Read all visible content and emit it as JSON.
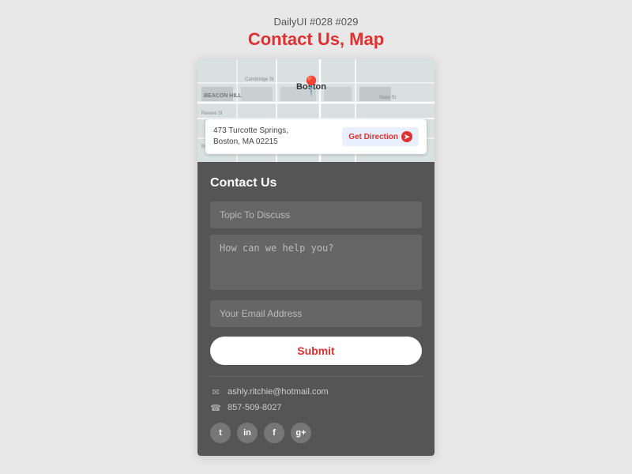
{
  "header": {
    "subtitle": "DailyUI #028 #029",
    "title": "Contact Us, Map"
  },
  "map": {
    "city_label": "Boston",
    "address_line1": "473 Turcotte Springs,",
    "address_line2": "Boston,  MA 02215",
    "direction_btn_label": "Get Direction"
  },
  "contact_form": {
    "heading": "Contact Us",
    "topic_placeholder": "Topic To Discuss",
    "message_placeholder": "How can we help you?",
    "email_placeholder": "Your Email Address",
    "submit_label": "Submit"
  },
  "contact_info": {
    "email": "ashly.ritchie@hotmail.com",
    "phone": "857-509-8027"
  },
  "social": {
    "twitter_label": "t",
    "linkedin_label": "in",
    "facebook_label": "f",
    "google_label": "g+"
  }
}
